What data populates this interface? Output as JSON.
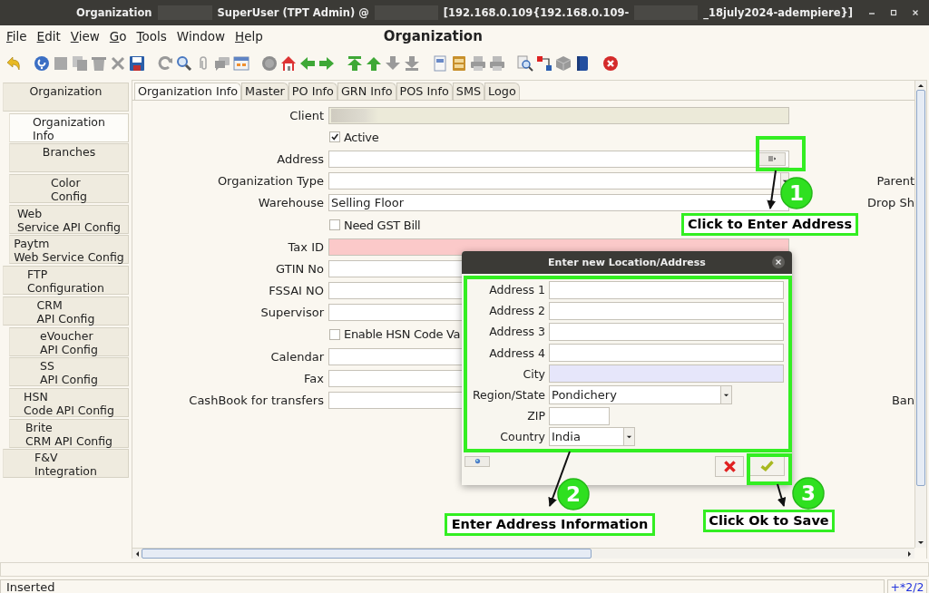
{
  "window": {
    "title_parts": [
      {
        "kind": "text",
        "text": "Organization"
      },
      {
        "kind": "redacted"
      },
      {
        "kind": "text",
        "text": "SuperUser (TPT Admin) @"
      },
      {
        "kind": "redacted"
      },
      {
        "kind": "text",
        "text": "[192.168.0.109{192.168.0.109-"
      },
      {
        "kind": "redacted"
      },
      {
        "kind": "text",
        "text": "_18july2024-adempiere}]"
      }
    ]
  },
  "menu": [
    {
      "label": "File",
      "mnemonic": true
    },
    {
      "label": "Edit",
      "mnemonic": true
    },
    {
      "label": "View",
      "mnemonic": true
    },
    {
      "label": "Go",
      "mnemonic": true
    },
    {
      "label": "Tools",
      "mnemonic": true
    },
    {
      "label": "Window",
      "mnemonic": false
    },
    {
      "label": "Help",
      "mnemonic": true
    }
  ],
  "heading": "Organization",
  "sidebar": {
    "items": [
      {
        "label": "Organization",
        "selected": false,
        "children": [
          {
            "label": "Organization\nInfo",
            "selected": true
          },
          {
            "label": "Branches",
            "selected": false
          },
          {
            "label": "Color\nConfig",
            "selected": false
          },
          {
            "label": "Web\nService API Config",
            "selected": false
          },
          {
            "label": "Paytm\nWeb Service Config",
            "selected": false
          }
        ]
      },
      {
        "label": "FTP\nConfiguration",
        "selected": false
      },
      {
        "label": "CRM\nAPI Config",
        "selected": false,
        "children": [
          {
            "label": "eVoucher\nAPI Config",
            "selected": false
          },
          {
            "label": "SS\nAPI Config",
            "selected": false
          },
          {
            "label": "HSN\nCode API Config",
            "selected": false
          },
          {
            "label": "Brite\nCRM API Config",
            "selected": false
          }
        ]
      },
      {
        "label": "F&V\nIntegration",
        "selected": false
      }
    ]
  },
  "tabs": [
    {
      "label": "Organization Info",
      "selected": true
    },
    {
      "label": "Master",
      "selected": false
    },
    {
      "label": "PO Info",
      "selected": false
    },
    {
      "label": "GRN Info",
      "selected": false
    },
    {
      "label": "POS Info",
      "selected": false
    },
    {
      "label": "SMS",
      "selected": false
    },
    {
      "label": "Logo",
      "selected": false
    }
  ],
  "form": {
    "rows": [
      {
        "label": "Client",
        "kind": "text",
        "readonly": true,
        "mandatory": false,
        "redacted": true
      },
      {
        "kind": "checkbox",
        "text": "Active",
        "checked": true
      },
      {
        "label": "Address",
        "kind": "lookup",
        "readonly": false,
        "mandatory": false
      },
      {
        "label": "Organization Type",
        "kind": "dropdown",
        "readonly": false,
        "mandatory": false,
        "side_label": "Parent"
      },
      {
        "label": "Warehouse",
        "kind": "text",
        "value": "Selling Floor",
        "readonly": false,
        "mandatory": false,
        "side_label": "Drop Sh"
      },
      {
        "kind": "checkbox",
        "text": "Need GST Bill",
        "checked": false
      },
      {
        "label": "Tax ID",
        "kind": "text",
        "readonly": false,
        "mandatory": true
      },
      {
        "label": "GTIN No",
        "kind": "text",
        "readonly": false,
        "mandatory": false
      },
      {
        "label": "FSSAI NO",
        "kind": "text",
        "readonly": false,
        "mandatory": false
      },
      {
        "label": "Supervisor",
        "kind": "text",
        "readonly": false,
        "mandatory": false
      },
      {
        "kind": "checkbox",
        "text": "Enable HSN Code Va",
        "checked": false
      },
      {
        "label": "Calendar",
        "kind": "text",
        "readonly": false,
        "mandatory": false
      },
      {
        "label": "Fax",
        "kind": "text",
        "readonly": false,
        "mandatory": false
      },
      {
        "label": "CashBook for transfers",
        "kind": "text",
        "readonly": false,
        "mandatory": false,
        "side_label": "Ban"
      }
    ]
  },
  "dialog": {
    "title": "Enter new Location/Address",
    "rows": [
      {
        "label": "Address 1",
        "kind": "text",
        "highlighted": false
      },
      {
        "label": "Address 2",
        "kind": "text",
        "highlighted": false
      },
      {
        "label": "Address 3",
        "kind": "text",
        "highlighted": false
      },
      {
        "label": "Address 4",
        "kind": "text",
        "highlighted": false
      },
      {
        "label": "City",
        "kind": "text",
        "highlighted": true
      },
      {
        "label": "Region/State",
        "kind": "dropdown",
        "value": "Pondichery"
      },
      {
        "label": "ZIP",
        "kind": "short"
      },
      {
        "label": "Country",
        "kind": "short_dropdown",
        "value": "India"
      }
    ]
  },
  "annotations": [
    {
      "number": "1",
      "label": "Click to Enter Address"
    },
    {
      "number": "2",
      "label": "Enter Address Information"
    },
    {
      "number": "3",
      "label": "Click Ok to Save"
    }
  ],
  "status_bar": {
    "message": "Inserted",
    "record": "+*2/2"
  }
}
